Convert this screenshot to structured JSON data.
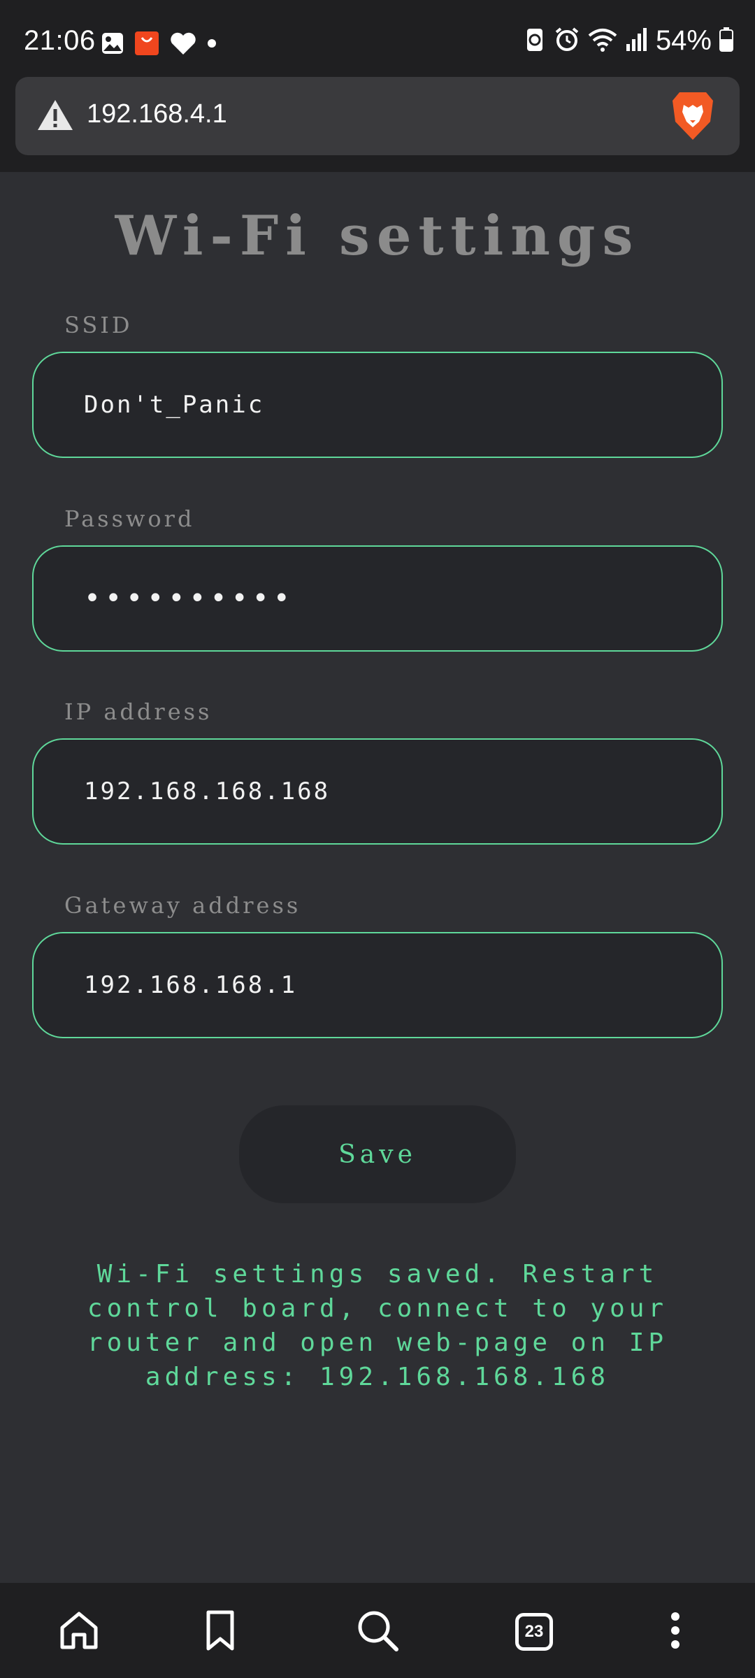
{
  "status_bar": {
    "time": "21:06",
    "battery": "54%",
    "icons": [
      "gallery-icon",
      "aliexpress-icon",
      "heart-icon",
      "dot-icon",
      "battery-saver-icon",
      "alarm-icon",
      "wifi-icon",
      "signal-icon",
      "battery-icon"
    ]
  },
  "browser": {
    "url": "192.168.4.1",
    "security_icon": "warning-icon",
    "browser_icon": "brave-lion-icon"
  },
  "page": {
    "title": "Wi-Fi settings",
    "fields": [
      {
        "label": "SSID",
        "value": "Don't_Panic"
      },
      {
        "label": "Password",
        "value": "••••••••••"
      },
      {
        "label": "IP address",
        "value": "192.168.168.168"
      },
      {
        "label": "Gateway address",
        "value": "192.168.168.1"
      }
    ],
    "save_label": "Save",
    "message": "Wi-Fi settings saved. Restart control board, connect to your router and open web-page on IP address: 192.168.168.168"
  },
  "bottom_nav": {
    "tab_count": "23",
    "icons": [
      "home-icon",
      "bookmark-icon",
      "search-icon",
      "tabs-icon",
      "more-icon"
    ]
  },
  "colors": {
    "accent": "#5fd89a",
    "page_bg": "#2e2f33",
    "input_bg": "#25262a",
    "chrome_bg": "#1f1f21"
  }
}
